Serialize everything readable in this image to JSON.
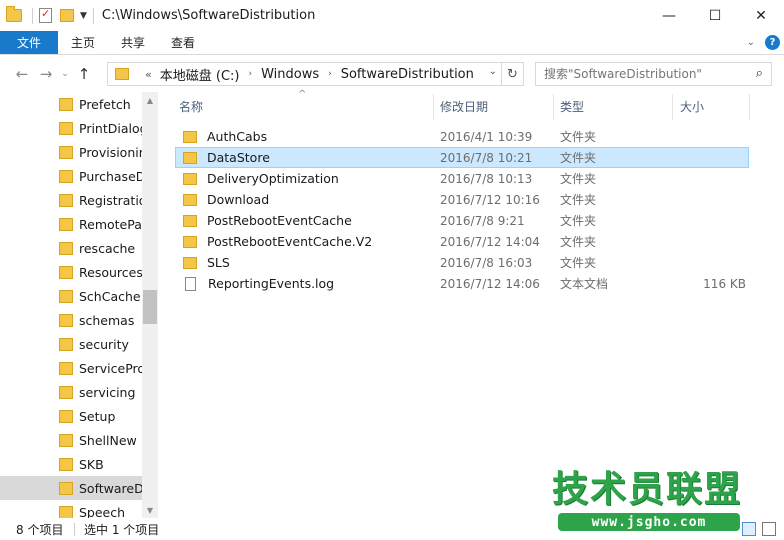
{
  "window": {
    "title": "C:\\Windows\\SoftwareDistribution",
    "minimize": "—",
    "maximize": "☐",
    "close": "✕"
  },
  "ribbon": {
    "file_tab": "文件",
    "tabs": [
      "主页",
      "共享",
      "查看"
    ],
    "expand_chevron": "⌄",
    "help": "?"
  },
  "nav": {
    "back": "←",
    "forward": "→",
    "recent": "⌄",
    "up": "↑",
    "address_prefix": "«",
    "breadcrumbs": [
      "本地磁盘 (C:)",
      "Windows",
      "SoftwareDistribution"
    ],
    "crumb_arrow": "›",
    "dropdown": "⌄",
    "refresh": "↻",
    "search_placeholder": "搜索\"SoftwareDistribution\"",
    "search_icon": "⌕"
  },
  "sidebar": {
    "items": [
      {
        "label": "Prefetch"
      },
      {
        "label": "PrintDialog"
      },
      {
        "label": "Provisioning"
      },
      {
        "label": "PurchaseDialog"
      },
      {
        "label": "Registration"
      },
      {
        "label": "RemotePackages"
      },
      {
        "label": "rescache"
      },
      {
        "label": "Resources"
      },
      {
        "label": "SchCache"
      },
      {
        "label": "schemas"
      },
      {
        "label": "security"
      },
      {
        "label": "ServiceProfiles"
      },
      {
        "label": "servicing"
      },
      {
        "label": "Setup"
      },
      {
        "label": "ShellNew"
      },
      {
        "label": "SKB"
      },
      {
        "label": "SoftwareDistribution",
        "selected": true
      },
      {
        "label": "Speech"
      }
    ],
    "scroll_up": "▲",
    "scroll_down": "▼"
  },
  "columns": {
    "name": "名称",
    "date": "修改日期",
    "type": "类型",
    "size": "大小",
    "sort_caret": "^"
  },
  "files": [
    {
      "name": "AuthCabs",
      "date": "2016/4/1 10:39",
      "type": "文件夹",
      "size": "",
      "kind": "folder"
    },
    {
      "name": "DataStore",
      "date": "2016/7/8 10:21",
      "type": "文件夹",
      "size": "",
      "kind": "folder",
      "selected": true
    },
    {
      "name": "DeliveryOptimization",
      "date": "2016/7/8 10:13",
      "type": "文件夹",
      "size": "",
      "kind": "folder"
    },
    {
      "name": "Download",
      "date": "2016/7/12 10:16",
      "type": "文件夹",
      "size": "",
      "kind": "folder"
    },
    {
      "name": "PostRebootEventCache",
      "date": "2016/7/8 9:21",
      "type": "文件夹",
      "size": "",
      "kind": "folder"
    },
    {
      "name": "PostRebootEventCache.V2",
      "date": "2016/7/12 14:04",
      "type": "文件夹",
      "size": "",
      "kind": "folder"
    },
    {
      "name": "SLS",
      "date": "2016/7/8 16:03",
      "type": "文件夹",
      "size": "",
      "kind": "folder"
    },
    {
      "name": "ReportingEvents.log",
      "date": "2016/7/12 14:06",
      "type": "文本文档",
      "size": "116 KB",
      "kind": "file"
    }
  ],
  "status": {
    "item_count": "8 个项目",
    "selected_count": "选中 1 个项目"
  },
  "watermark": {
    "title": "技术员联盟",
    "url": "www.jsgho.com"
  },
  "colors": {
    "accent": "#1979ca",
    "selection": "#cce8ff",
    "folder": "#f4c648",
    "watermark_green": "#2da34a"
  }
}
